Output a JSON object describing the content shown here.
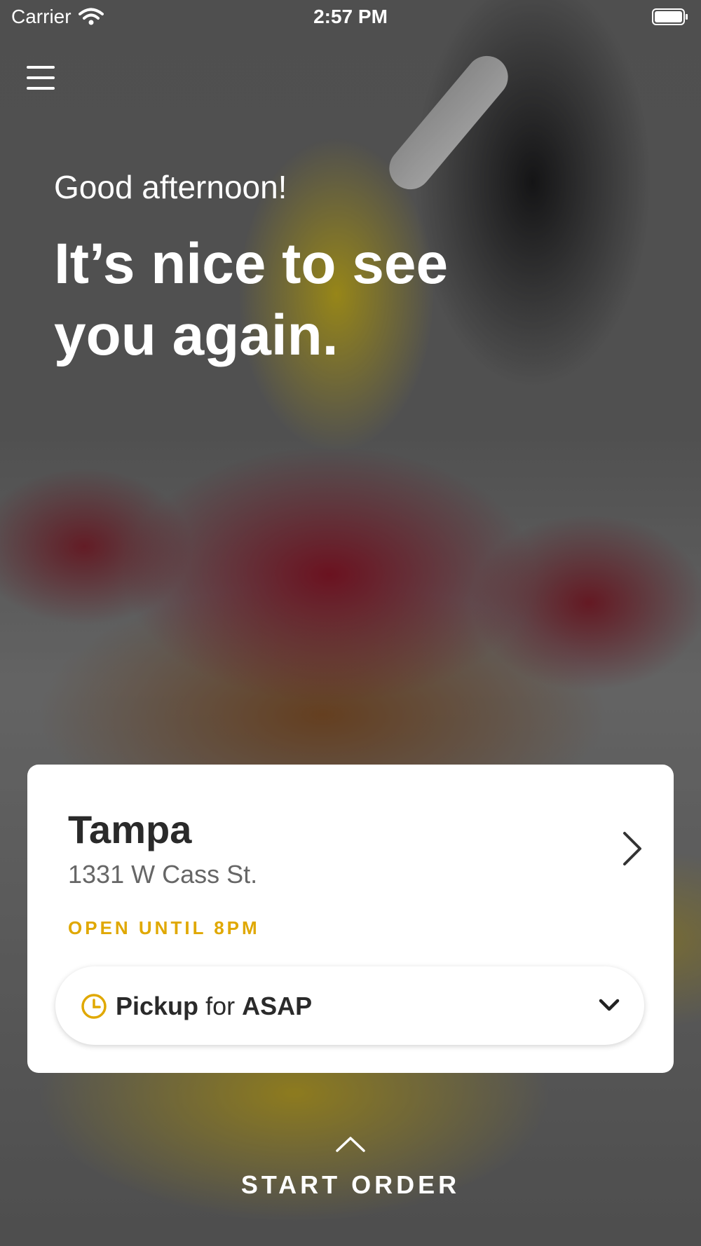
{
  "status_bar": {
    "carrier": "Carrier",
    "time": "2:57 PM"
  },
  "greeting": "Good afternoon!",
  "headline": "It’s nice to see you again.",
  "location": {
    "city": "Tampa",
    "address": "1331 W Cass St.",
    "hours": "OPEN UNTIL 8PM"
  },
  "order_mode": {
    "mode": "Pickup",
    "connector": "for",
    "time": "ASAP"
  },
  "start_order_label": "START ORDER",
  "colors": {
    "accent": "#e0a800",
    "card": "#ffffff"
  },
  "icons": [
    "wifi-icon",
    "battery-icon",
    "menu-icon",
    "chevron-right-icon",
    "clock-icon",
    "chevron-down-icon",
    "chevron-up-icon"
  ]
}
